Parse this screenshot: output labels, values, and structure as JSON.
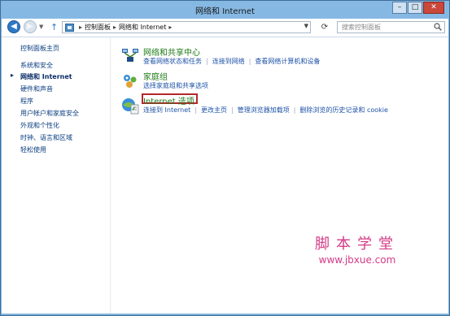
{
  "window": {
    "title": "网络和 Internet",
    "controls": [
      "minimize",
      "maximize",
      "close"
    ]
  },
  "nav": {
    "address": {
      "breadcrumbs": [
        "控制面板",
        "网络和 Internet"
      ]
    },
    "search": {
      "placeholder": "搜索控制面板"
    }
  },
  "sidebar": {
    "items": [
      {
        "label": "控制面板主页",
        "current": false
      },
      {
        "label": "系统和安全",
        "current": false
      },
      {
        "label": "网络和 Internet",
        "current": true
      },
      {
        "label": "硬件和声音",
        "current": false
      },
      {
        "label": "程序",
        "current": false
      },
      {
        "label": "用户帐户和家庭安全",
        "current": false
      },
      {
        "label": "外观和个性化",
        "current": false
      },
      {
        "label": "时钟、语言和区域",
        "current": false
      },
      {
        "label": "轻松使用",
        "current": false
      }
    ]
  },
  "categories": [
    {
      "title": "网络和共享中心",
      "icon": "network-sharing-icon",
      "links": [
        "查看网络状态和任务",
        "连接到网络",
        "查看网络计算机和设备"
      ]
    },
    {
      "title": "家庭组",
      "icon": "homegroup-icon",
      "links": [
        "选择家庭组和共享选项"
      ]
    },
    {
      "title": "Internet 选项",
      "icon": "internet-options-icon",
      "links": [
        "连接到 Internet",
        "更改主页",
        "管理浏览器加载项",
        "删除浏览的历史记录和 cookie"
      ]
    }
  ],
  "watermark": {
    "cn": "脚本学堂",
    "url": "www.jbxue.com"
  },
  "colors": {
    "accent": "#2d79c7",
    "category_title": "#1e7a17",
    "link": "#1e52a8",
    "highlight": "#b3282b",
    "watermark": "#d33a87"
  }
}
